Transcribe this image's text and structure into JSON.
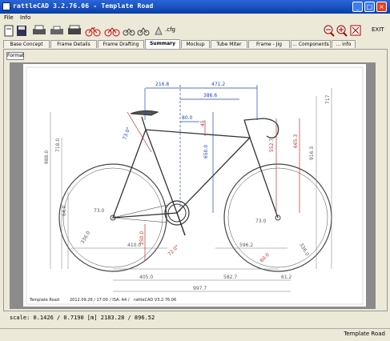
{
  "window": {
    "title": "rattleCAD  3.2.76.06 - Template Road"
  },
  "menu": {
    "file": "File",
    "info": "Info"
  },
  "toolbar": {
    "cfg_label": ".cfg",
    "exit_label": "EXIT"
  },
  "tabs": [
    "Base Concept",
    "Frame Details",
    "Frame Drafting",
    "Summary",
    "Mockup",
    "Tube Miter",
    "Frame - Jig",
    "... Components",
    "... info"
  ],
  "format_button": "Format",
  "drawing": {
    "dims": {
      "top_short": "216.8",
      "top_long": "471.2",
      "top_mid": "386.6",
      "saddle_x": "80.0",
      "saddle_y": "45",
      "seat_h": "650.0",
      "left_tall": "988.0",
      "left_mid": "718.0",
      "angle_seat": "73.0°",
      "right_stack": "552.7",
      "right_head": "665.3",
      "right_outer": "916.3",
      "right_top": "717",
      "left_low": "64.0",
      "crank_h": "250.0",
      "chain_left": "410.0",
      "chain_right": "596.2",
      "fork_ang": "72.0°",
      "bb_ang": "73.0",
      "rear_ang": "73.0",
      "wheel_left": "336.0",
      "wheel_right": "336.0",
      "bottom_a": "405.0",
      "bottom_b": "582.7",
      "bottom_c": "61.2",
      "bottom_total": "997.7",
      "front_center": "60.0"
    },
    "footer": {
      "name": "Template Road",
      "date": "2012.09.26 / 17:00",
      "scale": "/ ISA: A4 /",
      "app": "rattleCAD  V3.2.76.06"
    }
  },
  "scale_readout": "scale: 0.1426 / 0.7190  [m]  2183.28 / 896.52",
  "status": "Template Road"
}
